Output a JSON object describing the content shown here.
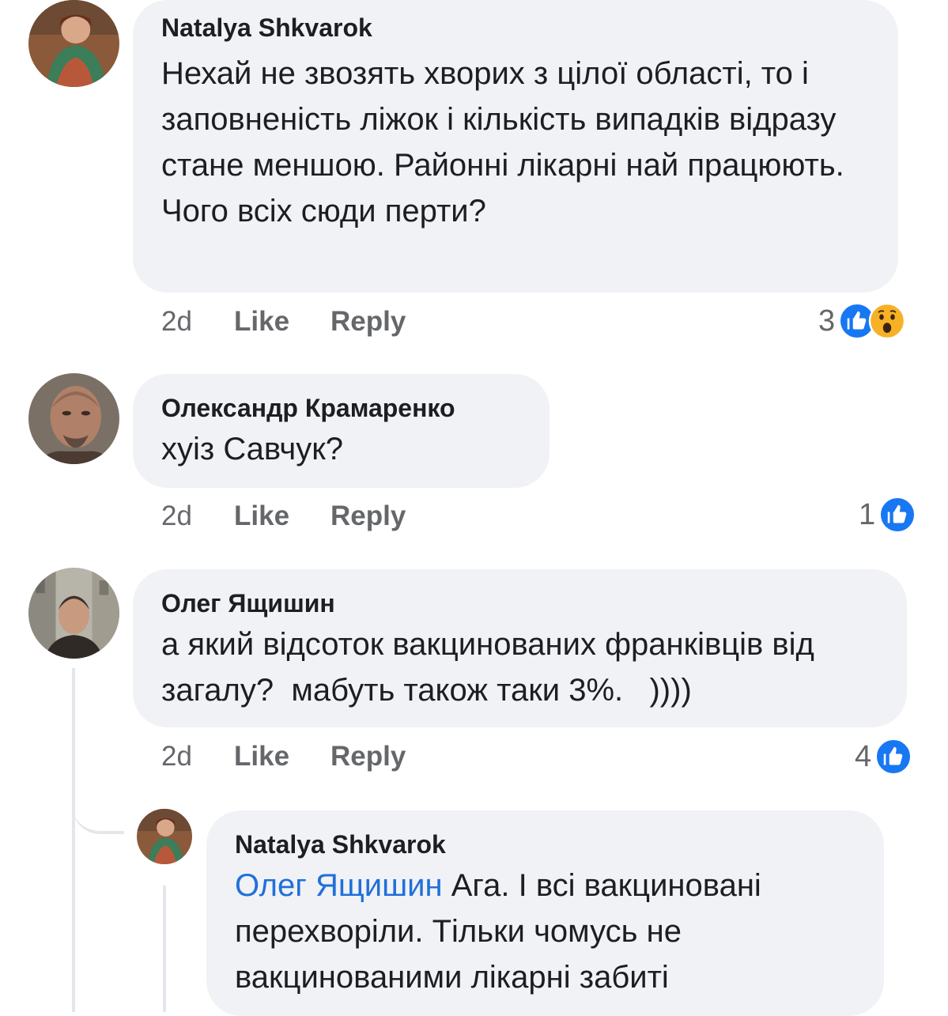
{
  "comments": [
    {
      "author": "Natalya Shkvarok",
      "text": "Нехай не звозять хворих з цілої області, то і заповненість ліжок і кількість випадків відразу стане меншою. Районні лікарні най працюють. Чого всіх сюди перти?",
      "time": "2d",
      "like_label": "Like",
      "reply_label": "Reply",
      "reaction_count": "3",
      "reactions": [
        "like-reaction-icon",
        "wow-reaction-icon"
      ]
    },
    {
      "author": "Олександр Крамаренко",
      "text": "хуіз Савчук?",
      "time": "2d",
      "like_label": "Like",
      "reply_label": "Reply",
      "reaction_count": "1",
      "reactions": [
        "like-reaction-icon"
      ]
    },
    {
      "author": "Олег Ящишин",
      "text": "а який відсоток вакцинованих франківців від загалу?  мабуть також таки 3%.   ))))",
      "time": "2d",
      "like_label": "Like",
      "reply_label": "Reply",
      "reaction_count": "4",
      "reactions": [
        "like-reaction-icon"
      ]
    }
  ],
  "reply": {
    "author": "Natalya Shkvarok",
    "mention": "Олег Ящишин",
    "text": " Ага. І всі вакциновані перехворіли. Тільки чомусь не вакцинованими лікарні забиті"
  },
  "colors": {
    "bubble": "#f0f2f5",
    "like_blue": "#1877f2",
    "mention_blue": "#216fdb",
    "meta_gray": "#65676b"
  }
}
